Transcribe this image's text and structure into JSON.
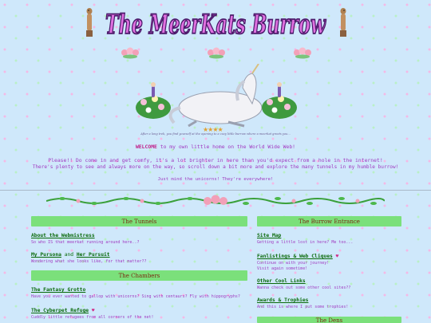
{
  "header": {
    "title": "The MeerKats Burrow"
  },
  "hero": {
    "caption": "After a long trek, you find yourself at the opening to a cozy little burrow where a meerkat greets you...",
    "stars": "★★★★"
  },
  "intro": {
    "welcome_bold": "WELCOME",
    "welcome_rest": " to my own little home on the World Wide Web!",
    "line2": "Please!! Do come in and get comfy, it's a lot brighter in here than you'd expect from a hole in the internet!",
    "line3": "There's plenty to see and always more on the way, so scroll down a bit more and explore the many tunnels in my humble burrow!",
    "line4": "Just mind the unicorns! They're everywhere!"
  },
  "left": {
    "tunnels_header": "The Tunnels",
    "webmistress_link": "About the Webmistress",
    "webmistress_desc": "So who IS that meerkat running around here..?",
    "pursona_link": "My Pursona",
    "and_text": " and ",
    "pursuit_link": "Her Pursuit",
    "pursona_desc": "Wondering what she looks like, for that matter??",
    "chambers_header": "The Chambers",
    "grotto_link": "The Fantasy Grotto",
    "grotto_desc": "Have you ever wanted to gallop with unicorns? Sing with centaurs? Fly with hippogryphs?",
    "refuge_link": "The Cyberpet Refuge",
    "refuge_heart": "♥",
    "refuge_desc": "Cuddly little refugees from all corners of the net!"
  },
  "right": {
    "entrance_header": "The Burrow Entrance",
    "sitemap_link": "Site Map",
    "sitemap_desc": "Getting a little lost in here? Me too...",
    "fanlistings_link": "Fanlistings & Web Cliques",
    "fanlistings_heart": "♥",
    "fanlistings_desc1": "Continue on with your journey!",
    "fanlistings_desc2": "Visit again sometime!",
    "coollinks_link": "Other Cool Links",
    "coollinks_desc": "Wanna check out some other cool sites??",
    "awards_link": "Awards & Trophies",
    "awards_desc": "And this is where I put some trophies!",
    "dens_header": "The Dens"
  },
  "colors": {
    "background": "#cfe8fb",
    "header_green": "#7be07b",
    "link_green": "#0a6a0a",
    "purple_text": "#a03ac0",
    "title_pink": "#d040d0"
  }
}
